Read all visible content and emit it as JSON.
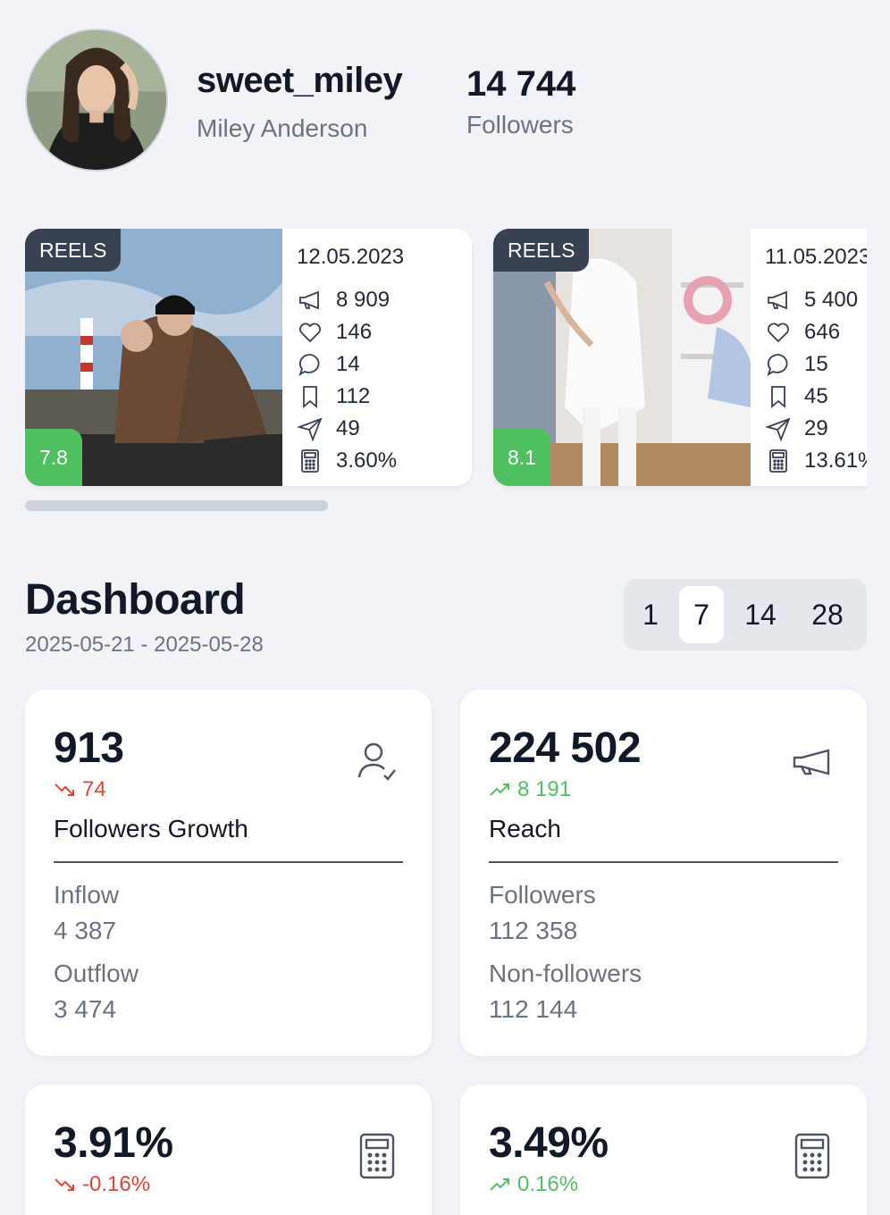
{
  "profile": {
    "username": "sweet_miley",
    "full_name": "Miley Anderson",
    "followers_count": "14 744",
    "followers_label": "Followers"
  },
  "reels": [
    {
      "badge": "REELS",
      "score": "7.8",
      "date": "12.05.2023",
      "reach": "8 909",
      "likes": "146",
      "comments": "14",
      "saves": "112",
      "shares": "49",
      "engagement": "3.60%"
    },
    {
      "badge": "REELS",
      "score": "8.1",
      "date": "11.05.2023",
      "reach": "5 400",
      "likes": "646",
      "comments": "15",
      "saves": "45",
      "shares": "29",
      "engagement": "13.61%"
    }
  ],
  "carousel": {
    "scroll_fraction": 0.36
  },
  "dashboard": {
    "title": "Dashboard",
    "range": "2025-05-21 - 2025-05-28",
    "periods": [
      "1",
      "7",
      "14",
      "28"
    ],
    "active_period": "7"
  },
  "metrics": {
    "followers_growth": {
      "value": "913",
      "delta": "74",
      "trend": "down",
      "label": "Followers Growth",
      "sub1_label": "Inflow",
      "sub1_value": "4 387",
      "sub2_label": "Outflow",
      "sub2_value": "3 474",
      "icon": "user-check-icon"
    },
    "reach": {
      "value": "224 502",
      "delta": "8 191",
      "trend": "up",
      "label": "Reach",
      "sub1_label": "Followers",
      "sub1_value": "112 358",
      "sub2_label": "Non-followers",
      "sub2_value": "112 144",
      "icon": "megaphone-icon"
    },
    "rate_a": {
      "value": "3.91%",
      "delta": "-0.16%",
      "trend": "down",
      "icon": "calculator-icon"
    },
    "rate_b": {
      "value": "3.49%",
      "delta": "0.16%",
      "trend": "up",
      "icon": "calculator-icon"
    }
  },
  "colors": {
    "background": "#f1f3f8",
    "card": "#ffffff",
    "badge": "#374151",
    "score_green": "#4fc160",
    "trend_up": "#4fc160",
    "trend_down": "#e0453a",
    "muted_text": "#6b7280"
  }
}
